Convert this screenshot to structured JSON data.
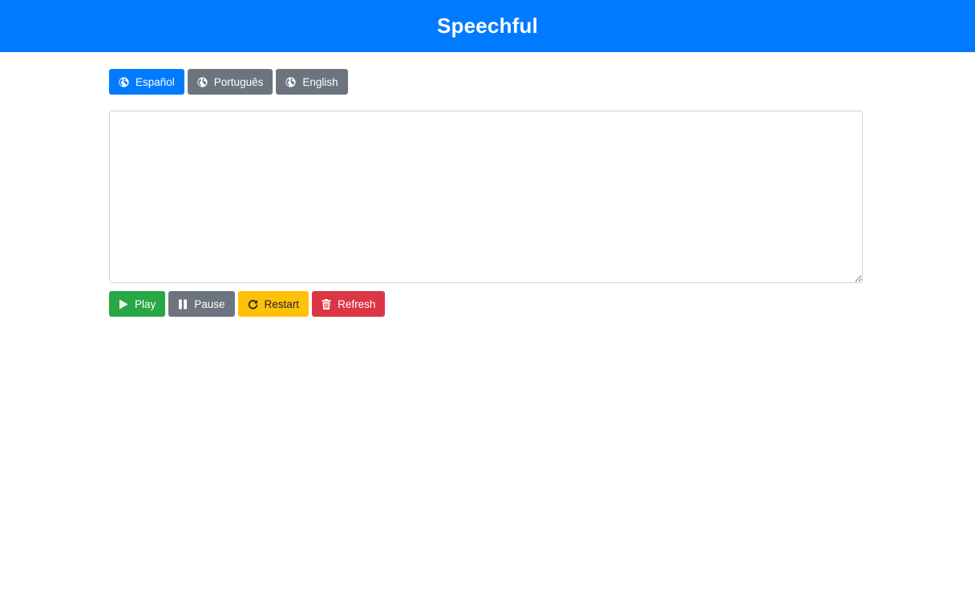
{
  "header": {
    "title": "Speechful",
    "color": "#007bff"
  },
  "languages": [
    {
      "label": "Español",
      "icon": "globe-icon",
      "active": true
    },
    {
      "label": "Português",
      "icon": "globe-icon",
      "active": false
    },
    {
      "label": "English",
      "icon": "globe-icon",
      "active": false
    }
  ],
  "text_input": {
    "value": "",
    "placeholder": ""
  },
  "controls": {
    "play_label": "Play",
    "pause_label": "Pause",
    "restart_label": "Restart",
    "refresh_label": "Refresh"
  },
  "colors": {
    "primary": "#007bff",
    "secondary": "#6c757d",
    "success": "#28a745",
    "warning": "#ffc107",
    "danger": "#dc3545"
  }
}
